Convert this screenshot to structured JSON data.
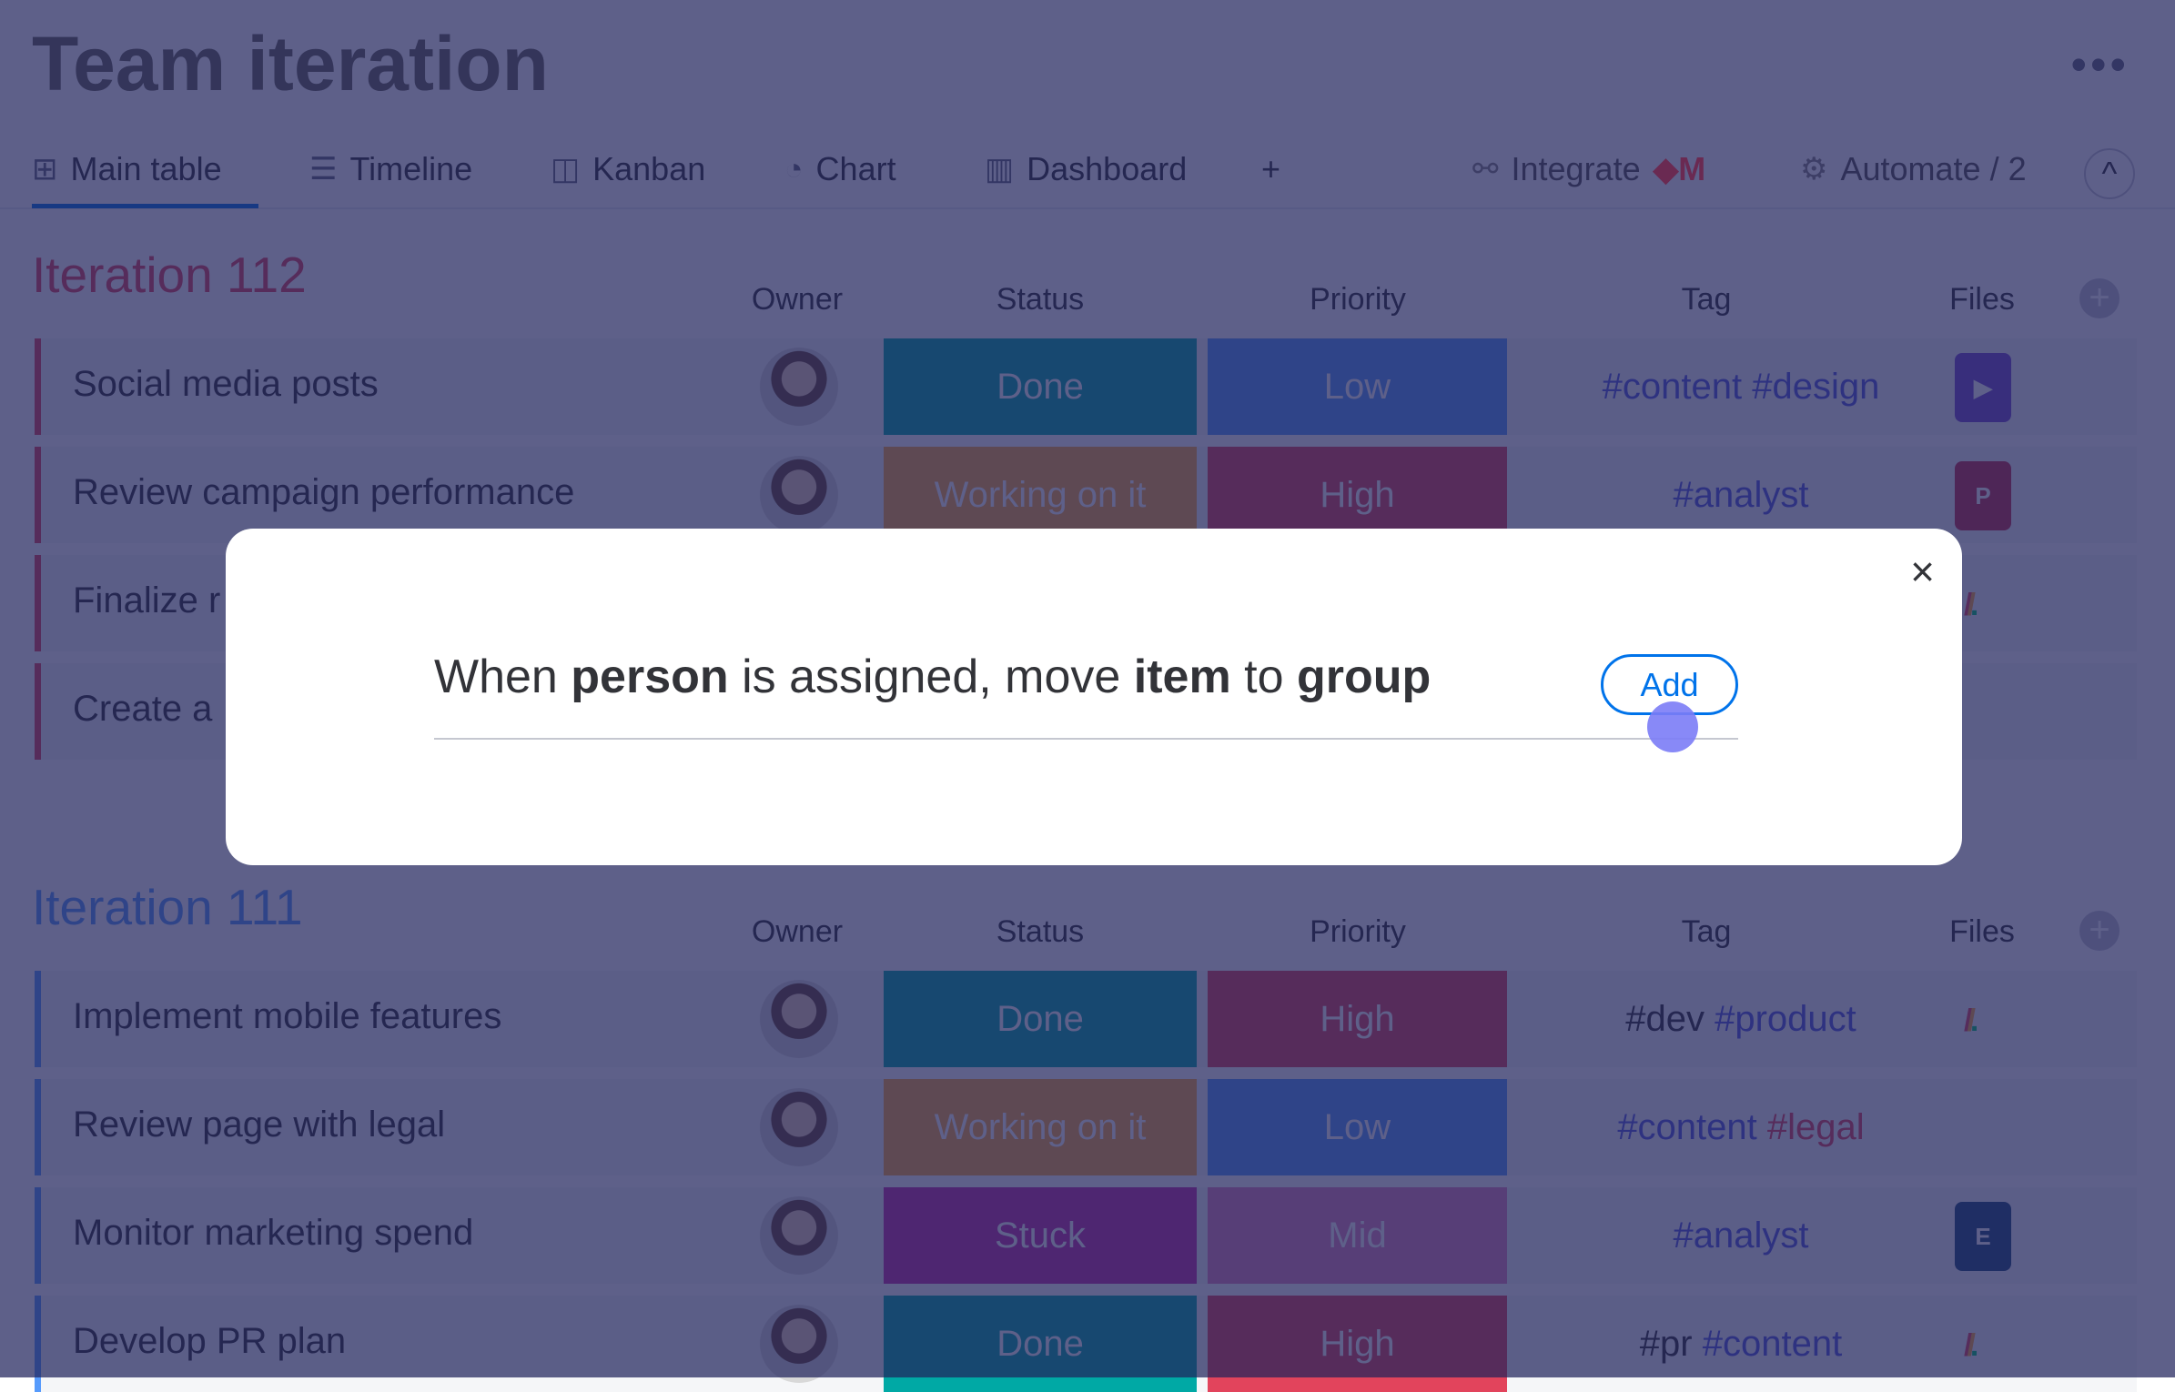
{
  "header": {
    "title": "Team iteration",
    "more_icon": "more-horizontal-icon"
  },
  "tabs": [
    {
      "label": "Main table",
      "icon": "⊞",
      "active": true
    },
    {
      "label": "Timeline",
      "icon": "☰"
    },
    {
      "label": "Kanban",
      "icon": "◫"
    },
    {
      "label": "Chart",
      "icon": "◔"
    },
    {
      "label": "Dashboard",
      "icon": "▥"
    }
  ],
  "toolbar": {
    "add": "+",
    "integrate": "Integrate",
    "automate": "Automate / 2",
    "collapse": "^"
  },
  "columns": {
    "owner": "Owner",
    "status": "Status",
    "priority": "Priority",
    "tag": "Tag",
    "files": "Files",
    "add": "+"
  },
  "groups": [
    {
      "title": "Iteration 112",
      "color": "#e2445c",
      "rows": [
        {
          "name": "Social media posts",
          "status": "Done",
          "priority": "Low",
          "tags": [
            "#content",
            "#design"
          ],
          "file": "video"
        },
        {
          "name": "Review campaign performance",
          "status": "Working on it",
          "priority": "High",
          "tags": [
            "#analyst"
          ],
          "file": "P"
        },
        {
          "name": "Finalize r",
          "file": "monday"
        },
        {
          "name": "Create a"
        }
      ]
    },
    {
      "title": "Iteration 111",
      "color": "#579bfc",
      "rows": [
        {
          "name": "Implement mobile features",
          "status": "Done",
          "priority": "High",
          "tags": [
            "#dev",
            "#product"
          ],
          "file": "monday"
        },
        {
          "name": "Review page with legal",
          "status": "Working on it",
          "priority": "Low",
          "tags": [
            "#content",
            "#legal"
          ]
        },
        {
          "name": "Monitor marketing spend",
          "status": "Stuck",
          "priority": "Mid",
          "tags": [
            "#analyst"
          ],
          "file": "E"
        },
        {
          "name": "Develop PR plan",
          "status": "Done",
          "priority": "High",
          "tags": [
            "#pr",
            "#content"
          ],
          "file": "monday"
        }
      ]
    }
  ],
  "colors": {
    "Done": "#00a9a5",
    "Working on it": "#fdab3d",
    "Stuck": "#c42fa8",
    "Low": "#579bfc",
    "High": "#e2445c",
    "Mid": "#e484bd"
  },
  "modal": {
    "w1": "When ",
    "b1": "person",
    "w2": " is assigned, move ",
    "b2": "item",
    "w3": " to ",
    "b3": "group",
    "add_label": "Add",
    "close": "×"
  }
}
